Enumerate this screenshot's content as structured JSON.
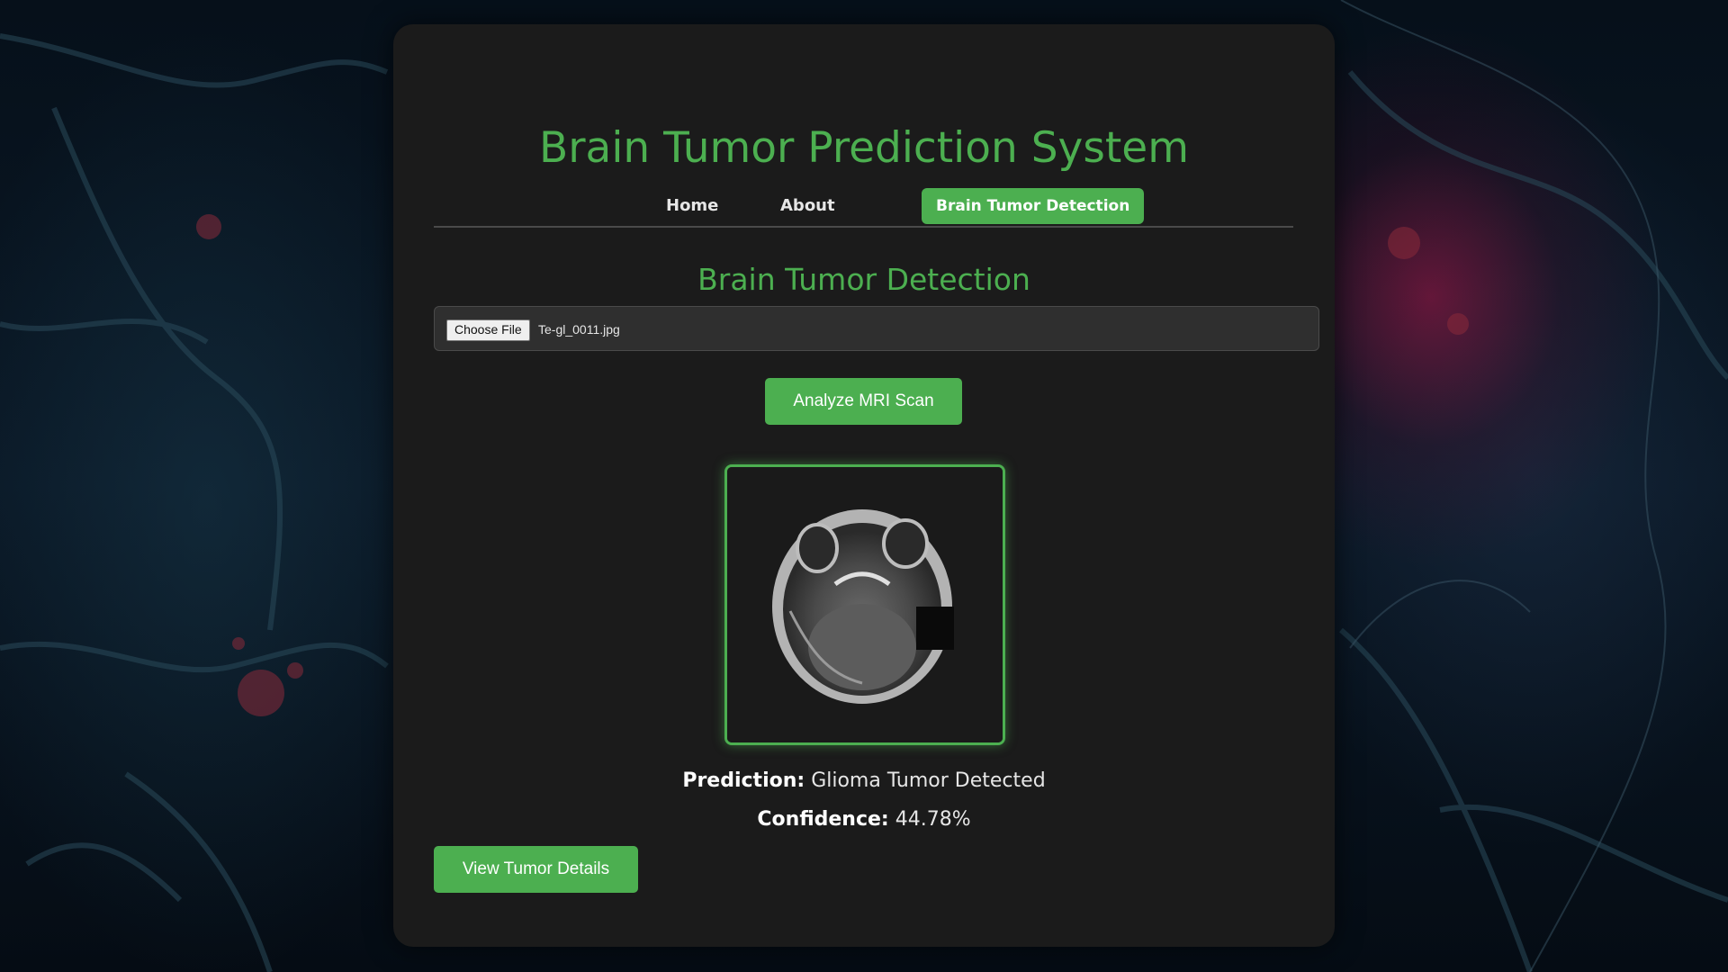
{
  "header": {
    "title": "Brain Tumor Prediction System"
  },
  "nav": {
    "items": [
      {
        "label": "Home",
        "active": false
      },
      {
        "label": "About",
        "active": false
      },
      {
        "label": "Brain Tumor Detection",
        "active": true
      }
    ]
  },
  "main": {
    "section_title": "Brain Tumor Detection",
    "file_input": {
      "button_label": "Choose File",
      "file_name": "Te-gl_0011.jpg"
    },
    "analyze_button": "Analyze MRI Scan",
    "result": {
      "prediction_label": "Prediction:",
      "prediction_value": "Glioma Tumor Detected",
      "confidence_label": "Confidence:",
      "confidence_value": "44.78%"
    },
    "details_button": "View Tumor Details"
  },
  "colors": {
    "accent": "#4caf50",
    "panel": "#1b1b1b",
    "background": "#0a1826"
  },
  "icons": {
    "scan_image": "mri-scan-image"
  }
}
